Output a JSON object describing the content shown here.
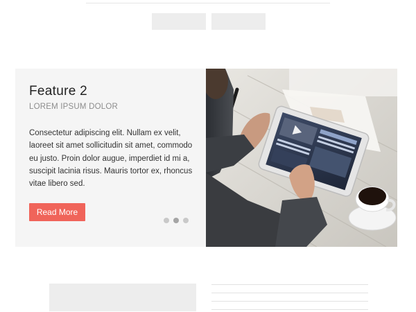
{
  "feature": {
    "title": "Feature 2",
    "subtitle": "LOREM IPSUM DOLOR",
    "body": "Consectetur adipiscing elit. Nullam ex velit, laoreet sit amet sollicitudin sit amet, commodo eu justo. Proin dolor augue, imperdiet id mi a, suscipit lacinia risus. Mauris tortor ex, rhoncus vitae libero sed.",
    "button_label": "Read More",
    "button_color": "#f0645a"
  },
  "slider": {
    "slide_count": 3,
    "active_slide": 2
  },
  "image": {
    "icon": "person-using-tablet-photo"
  }
}
